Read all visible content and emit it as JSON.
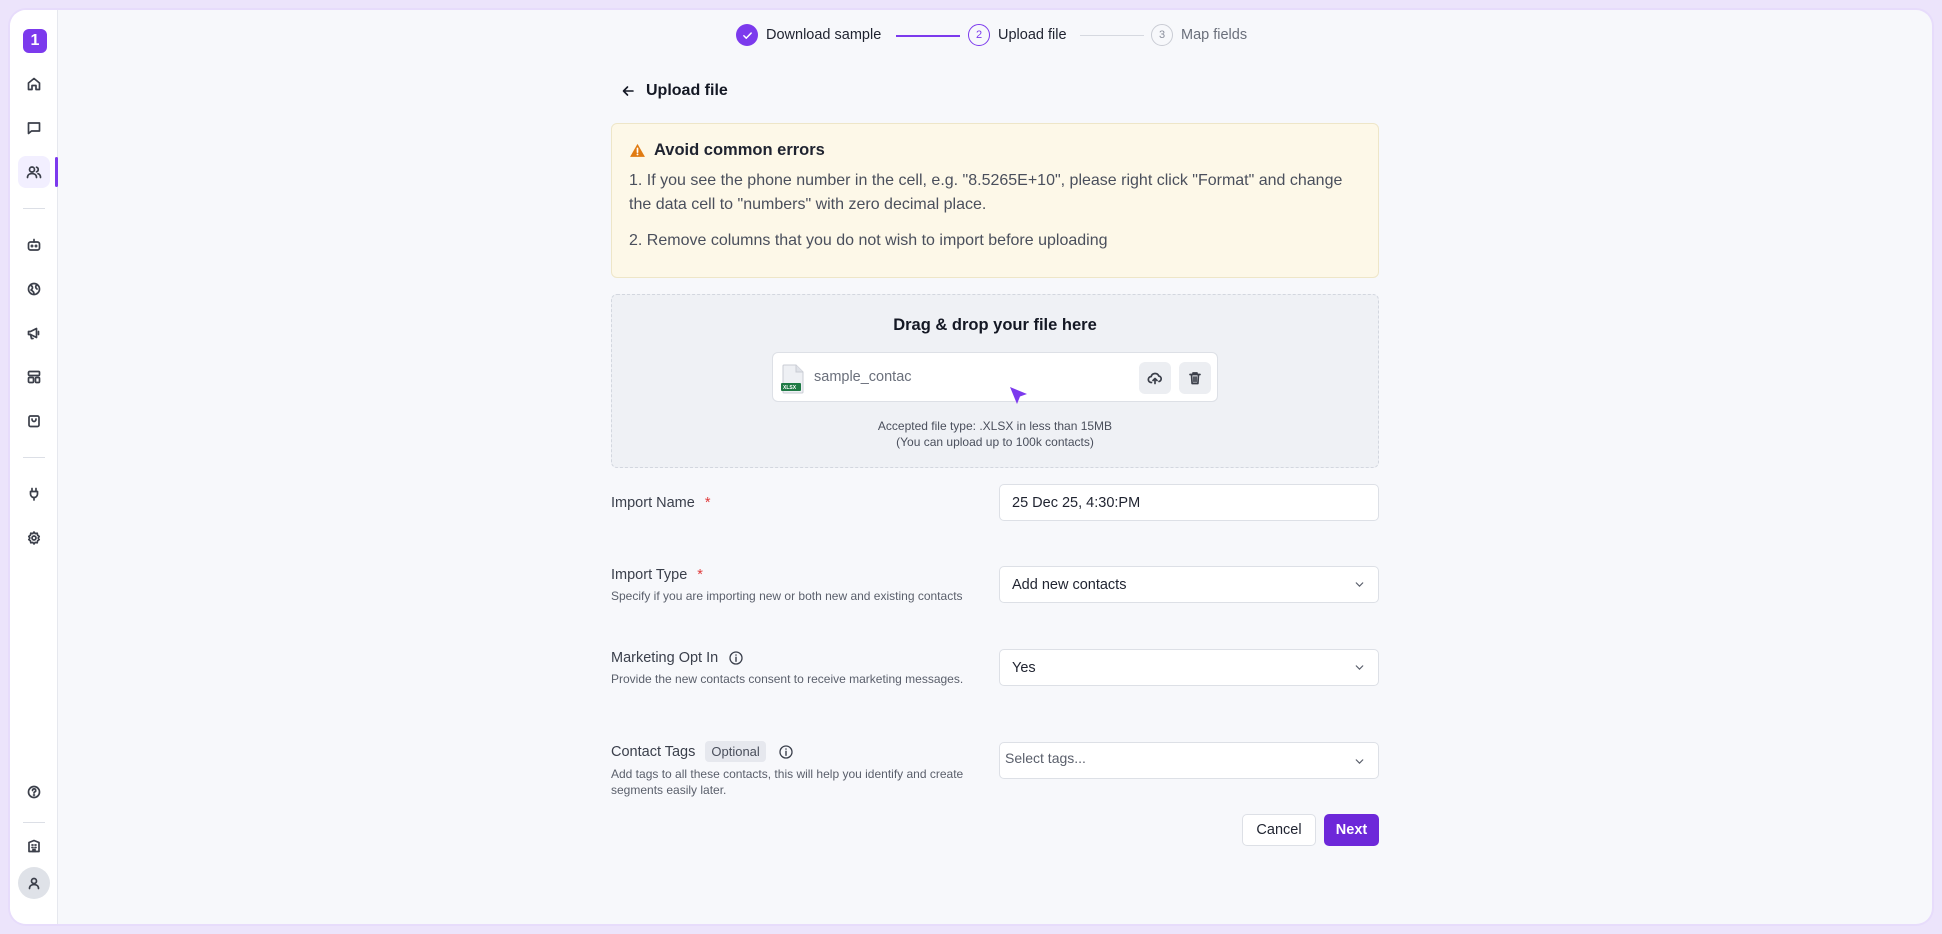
{
  "sidebar": {
    "logo": "1",
    "items": [
      {
        "name": "home-icon"
      },
      {
        "name": "chat-icon"
      },
      {
        "name": "contacts-icon",
        "active": true
      },
      {
        "name": "bot-icon"
      },
      {
        "name": "globe-icon"
      },
      {
        "name": "megaphone-icon"
      },
      {
        "name": "layout-icon"
      },
      {
        "name": "bag-icon"
      },
      {
        "name": "plug-icon"
      },
      {
        "name": "settings-icon"
      },
      {
        "name": "help-icon"
      },
      {
        "name": "building-icon"
      },
      {
        "name": "user-avatar-icon"
      }
    ]
  },
  "stepper": {
    "steps": [
      {
        "label": "Download sample",
        "state": "done",
        "number": ""
      },
      {
        "label": "Upload file",
        "state": "current",
        "number": "2"
      },
      {
        "label": "Map fields",
        "state": "todo",
        "number": "3"
      }
    ]
  },
  "page": {
    "title": "Upload file"
  },
  "warning": {
    "title": "Avoid common errors",
    "line1": "1. If you see the phone number in the cell, e.g. \"8.5265E+10\", please right click \"Format\" and change the data cell to \"numbers\" with zero decimal place.",
    "line2": "2. Remove columns that you do not wish to import before uploading"
  },
  "upload": {
    "title": "Drag & drop your file here",
    "file_name": "sample_contac",
    "file_type_badge": "XLSX",
    "accepted_line1": "Accepted file type: .XLSX in less than 15MB",
    "accepted_line2": "(You can upload up to 100k contacts)"
  },
  "form": {
    "import_name": {
      "label": "Import Name",
      "required": "*",
      "value": "25 Dec 25, 4:30:PM"
    },
    "import_type": {
      "label": "Import Type",
      "required": "*",
      "help": "Specify if you are importing new or both new and existing contacts",
      "value": "Add new contacts"
    },
    "marketing_opt_in": {
      "label": "Marketing Opt In",
      "help": "Provide the new contacts consent to receive marketing messages.",
      "value": "Yes"
    },
    "contact_tags": {
      "label": "Contact Tags",
      "badge": "Optional",
      "help": "Add tags to all these contacts, this will help you identify and create segments easily later.",
      "placeholder": "Select tags..."
    }
  },
  "actions": {
    "cancel": "Cancel",
    "next": "Next"
  },
  "colors": {
    "accent": "#7c3aed",
    "primary_button": "#6d28d9",
    "warning_bg": "#fdf8e8",
    "warning_icon": "#e07b12"
  }
}
